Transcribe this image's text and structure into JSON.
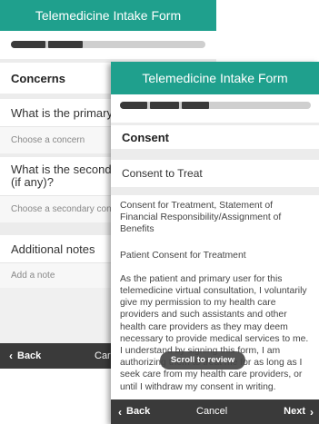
{
  "colors": {
    "header": "#1fa08d",
    "footer": "#3a3a3a",
    "progress": "#3a3a3a"
  },
  "back": {
    "header_title": "Telemedicine Intake Form",
    "progress_fraction": 0.36,
    "section_title": "Concerns",
    "q1_label": "What is the primary re",
    "q1_placeholder": "Choose a concern",
    "q2_label_line1": "What is the secondar",
    "q2_label_line2": "(if any)?",
    "q2_placeholder": "Choose a secondary conc",
    "q3_label": "Additional notes",
    "q3_placeholder": "Add a note",
    "back_label": "Back",
    "cancel_label": "Car"
  },
  "front": {
    "header_title": "Telemedicine Intake Form",
    "progress_fraction": 0.45,
    "section_title": "Consent",
    "subsection_title": "Consent to Treat",
    "consent_heading": "Consent for Treatment, Statement of Financial Responsibility/Assignment of Benefits",
    "patient_consent_title": "Patient Consent for Treatment",
    "consent_paragraph": "As the patient and primary user for this telemedicine virtual consultation, I voluntarily give my permission to my health care providers and such assistants and other health care providers as they may deem necessary to provide medical services to me. I understand by signing this form, I am authorizing them to treat me for as long as I seek care from my health care providers, or until I withdraw my consent in writing.",
    "scroll_toast": "Scroll to review",
    "back_label": "Back",
    "cancel_label": "Cancel",
    "next_label": "Next"
  },
  "icons": {
    "back": "chevron-left-icon",
    "next": "chevron-right-icon"
  }
}
